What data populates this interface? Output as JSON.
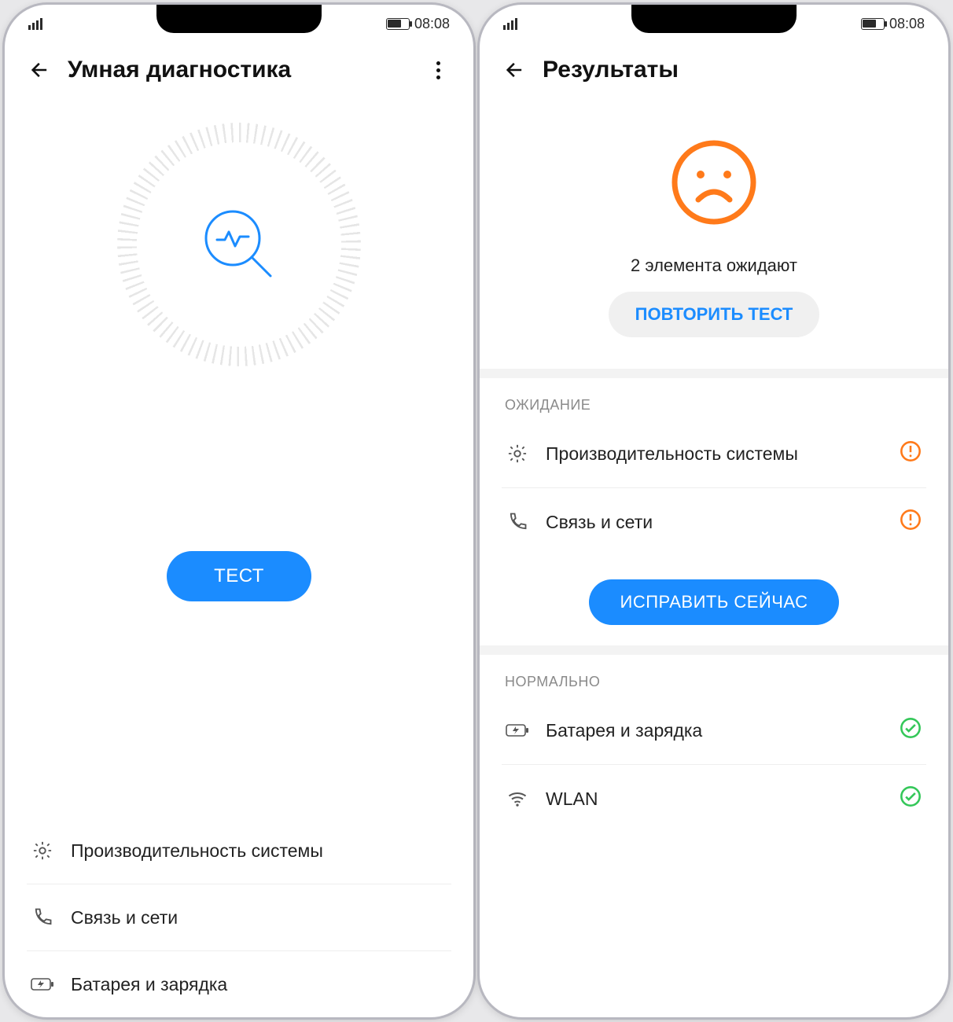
{
  "statusbar": {
    "time": "08:08"
  },
  "left": {
    "title": "Умная диагностика",
    "test_button": "ТЕСТ",
    "categories": [
      {
        "icon": "gear",
        "label": "Производительность системы"
      },
      {
        "icon": "phone",
        "label": "Связь и сети"
      },
      {
        "icon": "battery",
        "label": "Батарея и зарядка"
      }
    ]
  },
  "right": {
    "title": "Результаты",
    "pending_text": "2 элемента ожидают",
    "retry_button": "ПОВТОРИТЬ ТЕСТ",
    "fix_button": "ИСПРАВИТЬ СЕЙЧАС",
    "section_pending": "ОЖИДАНИЕ",
    "section_normal": "НОРМАЛЬНО",
    "pending_items": [
      {
        "icon": "gear",
        "label": "Производительность системы"
      },
      {
        "icon": "phone",
        "label": "Связь и сети"
      }
    ],
    "normal_items": [
      {
        "icon": "battery",
        "label": "Батарея и зарядка"
      },
      {
        "icon": "wifi",
        "label": "WLAN"
      }
    ]
  }
}
